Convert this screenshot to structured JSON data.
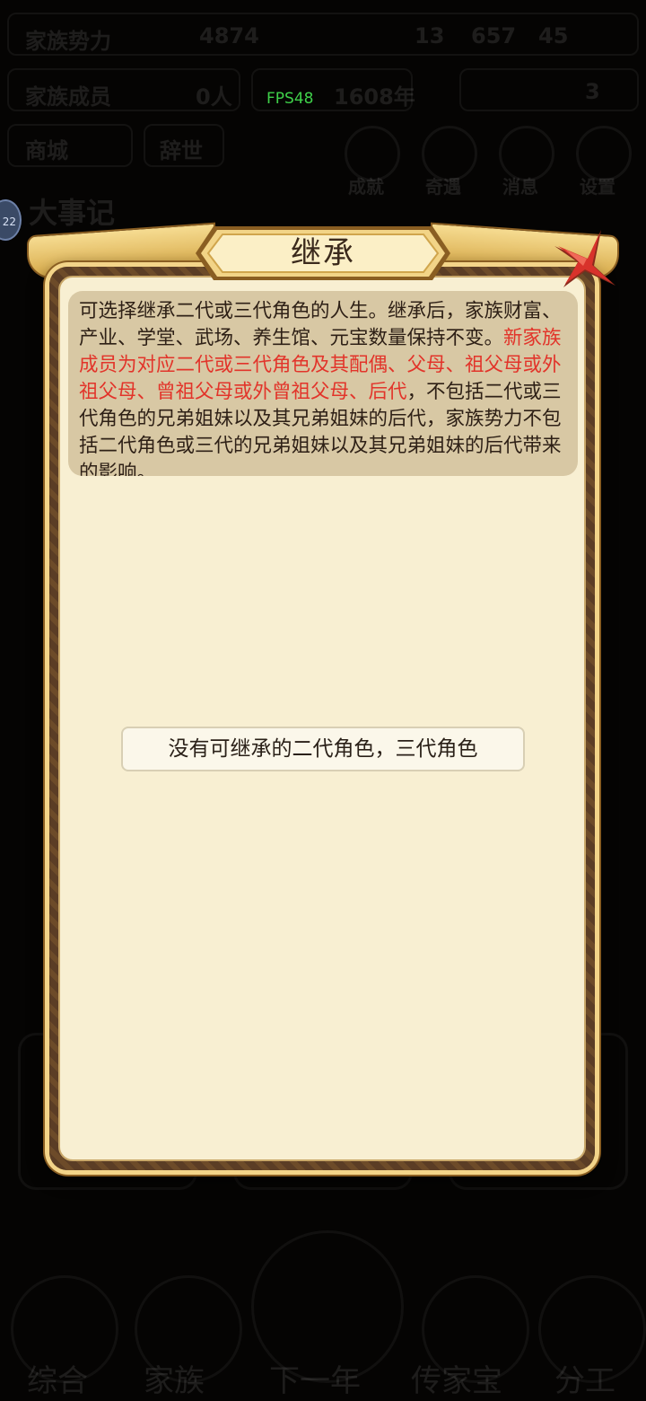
{
  "background": {
    "top_stats": {
      "power_label": "家族势力",
      "power_value": "4874",
      "res_a": "13",
      "res_b": "657",
      "res_c": "45"
    },
    "members_row": {
      "label": "家族成员",
      "count": "0人",
      "year": "1608年",
      "right_value": "3"
    },
    "tabs": [
      "商城",
      "辞世"
    ],
    "circle_labels": [
      "成就",
      "奇遇",
      "消息",
      "设置"
    ],
    "section_title": "大事记",
    "avatar_text": "22",
    "bottom_nav": [
      "综合",
      "家族",
      "下一年",
      "传家宝",
      "分工"
    ]
  },
  "fps": "FPS48",
  "modal": {
    "title": "继承",
    "description": {
      "intro": "可选择继承二代或三代角色的人生。继承后，家族财富、产业、学堂、武场、养生馆、元宝数量保持不变。",
      "highlight": "新家族成员为对应二代或三代角色及其配偶、父母、祖父母或外祖父母、曾祖父母或外曾祖父母、后代",
      "outro": "，不包括二代或三代角色的兄弟姐妹以及其兄弟姐妹的后代，家族势力不包括二代角色或三代的兄弟姐妹以及其兄弟姐妹的后代带来的影响。"
    },
    "empty_message": "没有可继承的二代角色，三代角色",
    "colors": {
      "highlight": "#e2342a",
      "panel": "#f8efd2",
      "frame_gold": "#f3d489",
      "close_red": "#d8322b"
    }
  }
}
